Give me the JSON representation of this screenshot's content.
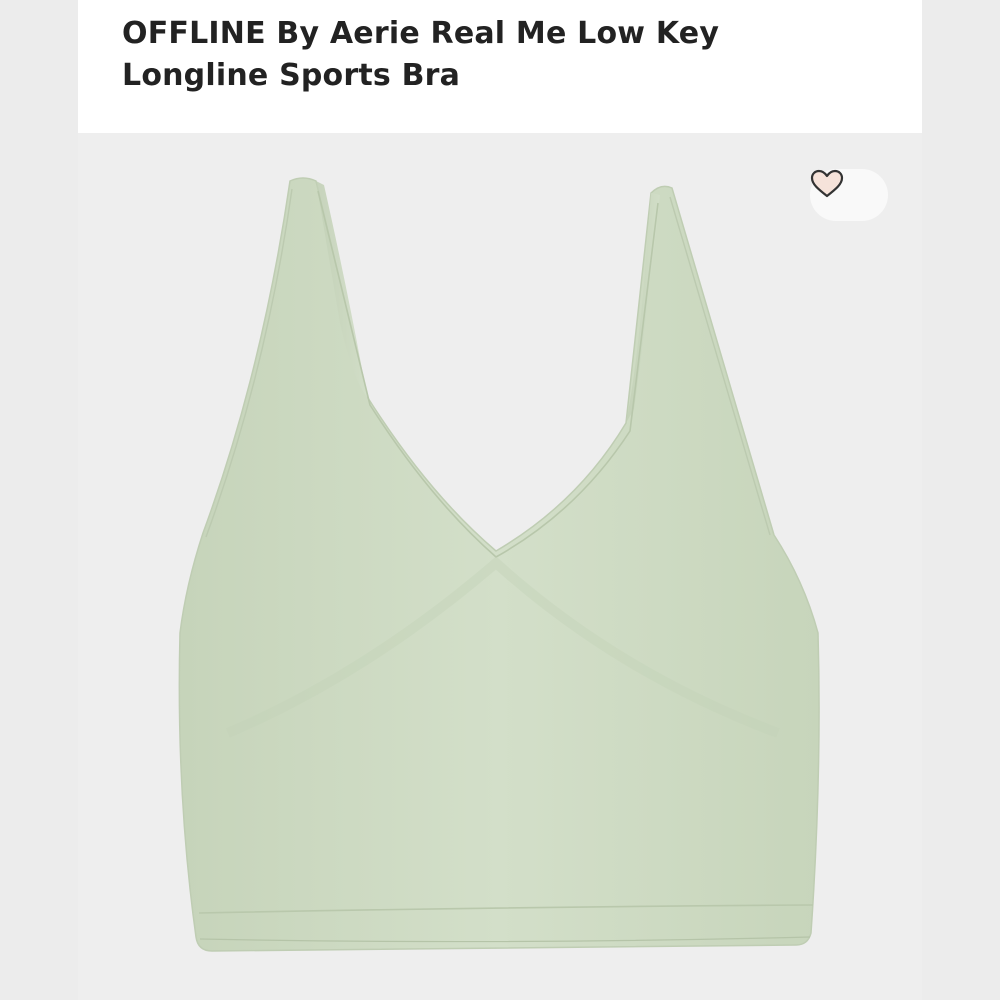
{
  "product": {
    "title_line1": "OFFLINE By Aerie Real Me Low Key",
    "title_line2": "Longline Sports Bra"
  },
  "image": {
    "subject": "sage green longline sports bra",
    "garment_color": "#cfdcc4",
    "background_color": "#eeeeee"
  },
  "favorite": {
    "icon": "heart-outline-icon",
    "state": "not-favorited"
  }
}
